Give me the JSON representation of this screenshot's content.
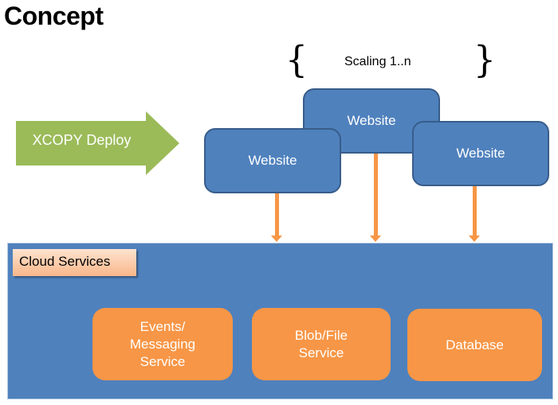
{
  "title": "Concept",
  "scaling": {
    "label": "Scaling 1..n",
    "brace_left": "{",
    "brace_right": "}"
  },
  "deploy": {
    "label": "XCOPY Deploy",
    "color": "#9bbb59"
  },
  "websites": [
    {
      "label": "Website"
    },
    {
      "label": "Website"
    },
    {
      "label": "Website"
    }
  ],
  "cloud": {
    "label": "Cloud Services",
    "color": "#4f81bd"
  },
  "services": [
    {
      "label": "Events/\nMessaging\nService"
    },
    {
      "label": "Blob/File\nService"
    },
    {
      "label": "Database"
    }
  ],
  "colors": {
    "website_fill": "#4f81bd",
    "website_border": "#385d8a",
    "connector": "#f79646",
    "service_fill": "#f79646",
    "deploy_arrow": "#9bbb59"
  }
}
